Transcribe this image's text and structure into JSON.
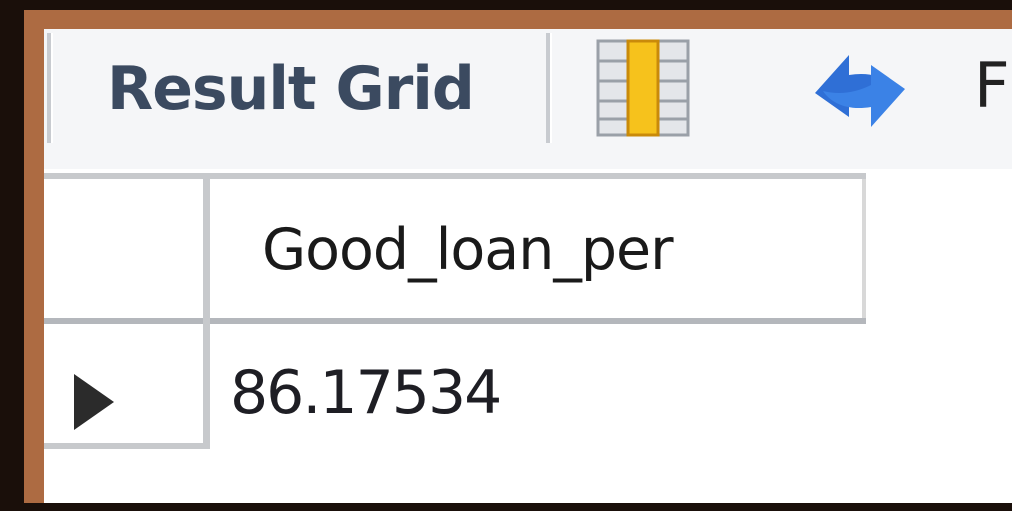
{
  "toolbar": {
    "result_grid_label": "Result Grid",
    "next_label_partial": "F",
    "icons": [
      "grid-view-icon",
      "refresh-icon"
    ]
  },
  "result_table": {
    "columns": [
      "Good_loan_per"
    ],
    "rows": [
      [
        "86.17534"
      ]
    ]
  },
  "colors": {
    "frame": "#ad6b42",
    "background": "#1a0f0a",
    "toolbar_bg": "#f5f6f8",
    "label_text": "#3b4a60",
    "grid_highlight": "#f6c21c",
    "refresh_blue": "#2f6fd6"
  }
}
